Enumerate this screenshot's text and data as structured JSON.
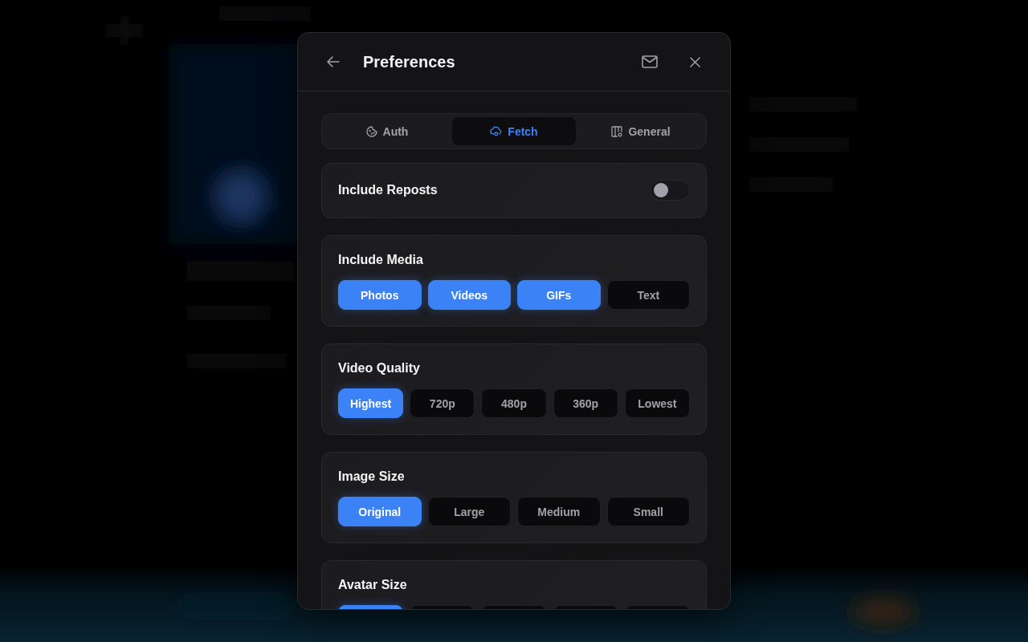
{
  "dialog": {
    "title": "Preferences"
  },
  "tabs": [
    {
      "label": "Auth",
      "selected": false
    },
    {
      "label": "Fetch",
      "selected": true
    },
    {
      "label": "General",
      "selected": false
    }
  ],
  "sections": [
    {
      "kind": "toggle",
      "title": "Include Reposts",
      "on": false
    },
    {
      "kind": "choices",
      "title": "Include Media",
      "options": [
        {
          "label": "Photos",
          "selected": true
        },
        {
          "label": "Videos",
          "selected": true
        },
        {
          "label": "GIFs",
          "selected": true
        },
        {
          "label": "Text",
          "selected": false
        }
      ]
    },
    {
      "kind": "choices",
      "title": "Video Quality",
      "options": [
        {
          "label": "Highest",
          "selected": true
        },
        {
          "label": "720p",
          "selected": false
        },
        {
          "label": "480p",
          "selected": false
        },
        {
          "label": "360p",
          "selected": false
        },
        {
          "label": "Lowest",
          "selected": false
        }
      ]
    },
    {
      "kind": "choices",
      "title": "Image Size",
      "options": [
        {
          "label": "Original",
          "selected": true
        },
        {
          "label": "Large",
          "selected": false
        },
        {
          "label": "Medium",
          "selected": false
        },
        {
          "label": "Small",
          "selected": false
        }
      ]
    },
    {
      "kind": "choices",
      "title": "Avatar Size",
      "options": [
        {
          "selected": true
        },
        {
          "selected": false
        },
        {
          "selected": false
        },
        {
          "selected": false
        },
        {
          "selected": false
        }
      ]
    }
  ]
}
